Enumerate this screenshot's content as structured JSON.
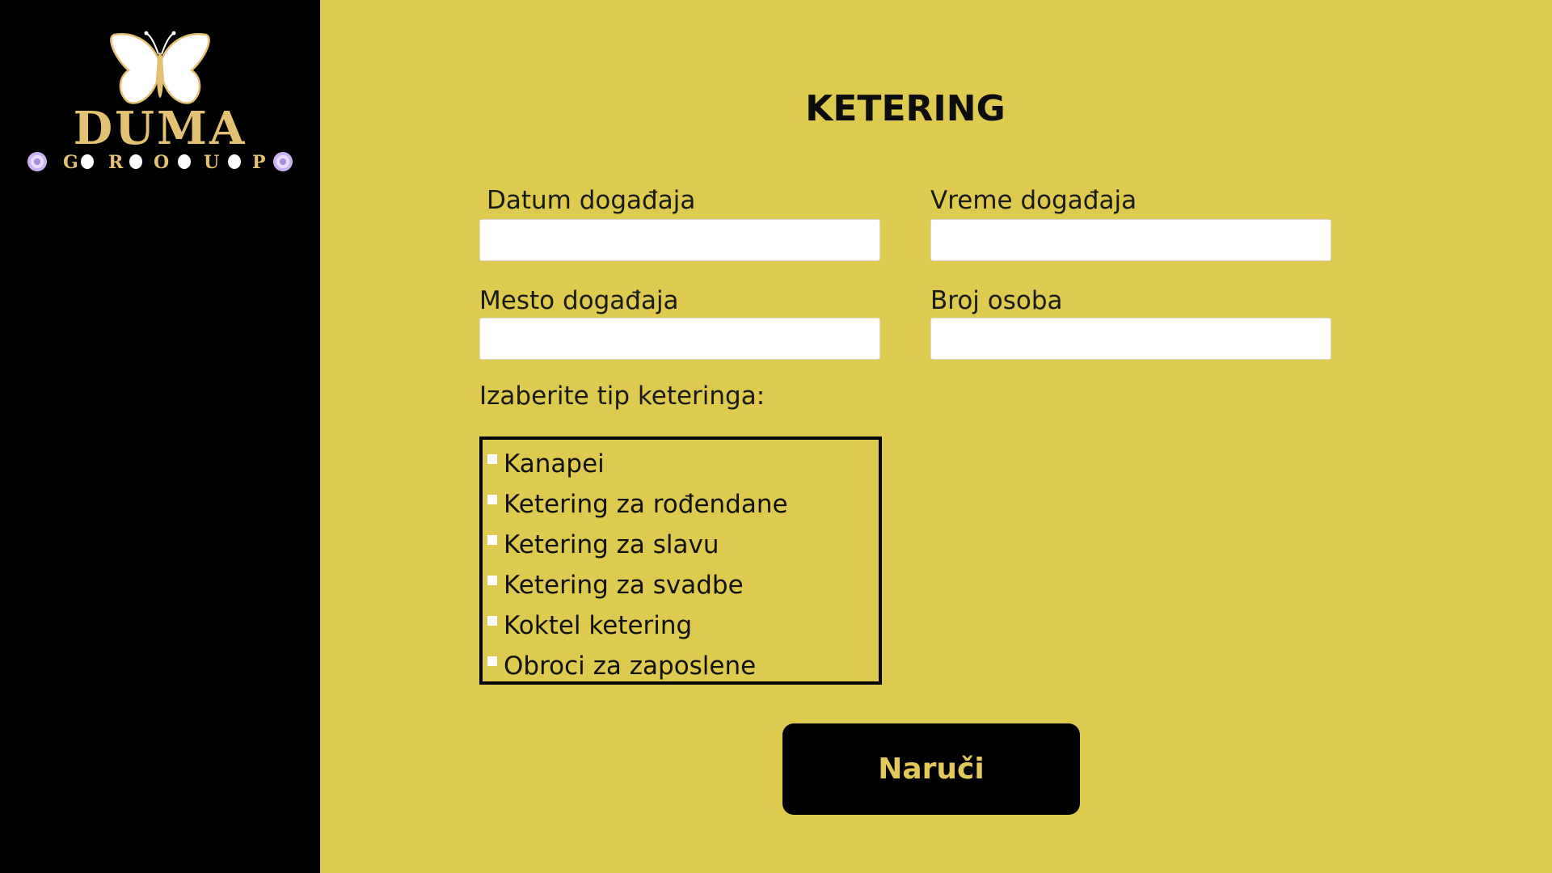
{
  "brand": {
    "name": "DUMA",
    "tagline": "GROUP",
    "icon": "butterfly-icon",
    "accent_color": "#E3C072"
  },
  "form": {
    "title": "KETERING",
    "date_label": "Datum događaja",
    "time_label": "Vreme događaja",
    "place_label": "Mesto događaja",
    "guests_label": "Broj osoba",
    "catering_type_label": "Izaberite tip keteringa:",
    "catering_options": [
      "Kanapei",
      "Ketering za rođendane",
      "Ketering za slavu",
      "Ketering za svadbe",
      "Koktel ketering",
      "Obroci za zaposlene"
    ],
    "submit_label": "Naruči"
  },
  "colors": {
    "background": "#DDCA4E",
    "sidebar": "#000000",
    "button_text": "#E3C85A"
  }
}
